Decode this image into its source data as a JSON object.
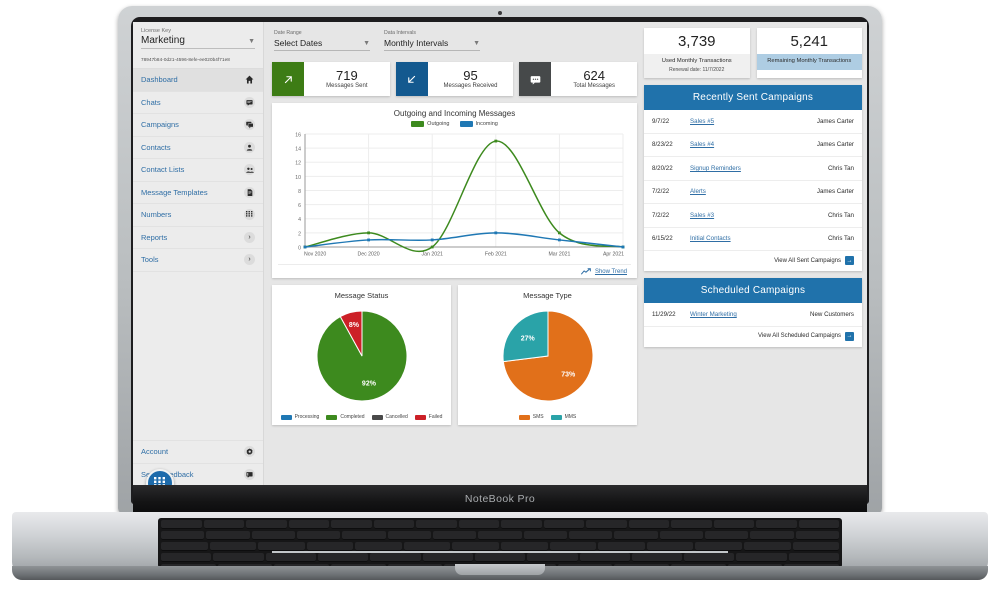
{
  "device": {
    "brand_label": "NoteBook Pro"
  },
  "sidebar": {
    "license_label": "License Key",
    "license_value": "Marketing",
    "license_key": "78947b84-0d21-4596-8efe-ee020b4f71e8",
    "items": [
      {
        "label": "Dashboard",
        "icon": "home-icon",
        "glyph": "⌂",
        "active": true
      },
      {
        "label": "Chats",
        "icon": "chat-icon",
        "glyph": "▤",
        "active": false
      },
      {
        "label": "Campaigns",
        "icon": "chats-icon",
        "glyph": "❐",
        "active": false
      },
      {
        "label": "Contacts",
        "icon": "person-icon",
        "glyph": "●",
        "active": false
      },
      {
        "label": "Contact Lists",
        "icon": "people-icon",
        "glyph": "●",
        "active": false
      },
      {
        "label": "Message Templates",
        "icon": "document-icon",
        "glyph": "▤",
        "active": false
      },
      {
        "label": "Numbers",
        "icon": "keypad-icon",
        "glyph": "∷",
        "active": false
      },
      {
        "label": "Reports",
        "icon": "chevron-right-icon",
        "glyph": "›",
        "active": false
      },
      {
        "label": "Tools",
        "icon": "chevron-right-icon",
        "glyph": "›",
        "active": false
      }
    ],
    "bottom_items": [
      {
        "label": "Account",
        "icon": "gear-icon",
        "glyph": "⚙"
      },
      {
        "label": "Send Feedback",
        "icon": "feedback-icon",
        "glyph": "▤"
      }
    ],
    "fab_icon": "apps-grid-icon",
    "fab_glyph": "☷"
  },
  "filters": [
    {
      "label": "Date Range",
      "value": "Select Dates"
    },
    {
      "label": "Data Intervals",
      "value": "Monthly Intervals"
    }
  ],
  "stats": [
    {
      "value": "719",
      "caption": "Messages Sent",
      "color": "#3d7c15",
      "icon": "arrow-up-right-icon",
      "glyph": "↗"
    },
    {
      "value": "95",
      "caption": "Messages Received",
      "color": "#13598f",
      "icon": "arrow-down-left-icon",
      "glyph": "↙"
    },
    {
      "value": "624",
      "caption": "Total Messages",
      "color": "#46494a",
      "icon": "message-icon",
      "glyph": "▤"
    }
  ],
  "transactions": [
    {
      "value": "3,739",
      "caption": "Used Monthly Transactions",
      "sub": "Renewal date: 11/7/2022",
      "style": "grey"
    },
    {
      "value": "5,241",
      "caption": "Remaining Monthly Transactions",
      "sub": "",
      "style": "blue"
    }
  ],
  "line_card": {
    "trend_link": "Show Trend",
    "trend_icon": "trend-line-icon"
  },
  "recently_sent": {
    "title": "Recently Sent Campaigns",
    "rows": [
      {
        "date": "9/7/22",
        "name": "Sales #5",
        "owner": "James Carter"
      },
      {
        "date": "8/23/22",
        "name": "Sales #4",
        "owner": "James Carter"
      },
      {
        "date": "8/20/22",
        "name": "Signup Reminders",
        "owner": "Chris Tan"
      },
      {
        "date": "7/2/22",
        "name": "Alerts",
        "owner": "James Carter"
      },
      {
        "date": "7/2/22",
        "name": "Sales #3",
        "owner": "Chris Tan"
      },
      {
        "date": "6/15/22",
        "name": "Initial Contacts",
        "owner": "Chris Tan"
      }
    ],
    "footer_label": "View All Sent Campaigns",
    "footer_icon": "arrow-right-box-icon"
  },
  "scheduled": {
    "title": "Scheduled Campaigns",
    "rows": [
      {
        "date": "11/29/22",
        "name": "Winter Marketing",
        "owner": "New Customers"
      }
    ],
    "footer_label": "View All Scheduled Campaigns",
    "footer_icon": "arrow-right-box-icon"
  },
  "chart_data": [
    {
      "type": "line",
      "title": "Outgoing and Incoming Messages",
      "categories": [
        "Nov 2020",
        "Dec 2020",
        "Jan 2021",
        "Feb 2021",
        "Mar 2021",
        "Apr 2021"
      ],
      "series": [
        {
          "name": "Outgoing",
          "values": [
            0,
            2,
            0,
            15,
            2,
            0
          ],
          "color": "#3d8a1e"
        },
        {
          "name": "Incoming",
          "values": [
            0,
            1,
            1,
            2,
            1,
            0
          ],
          "color": "#1f78b4"
        }
      ],
      "xlabel": "",
      "ylabel": "",
      "ylim": [
        0,
        16
      ],
      "yticks": [
        0,
        2,
        4,
        6,
        8,
        10,
        12,
        14,
        16
      ],
      "grid": true,
      "legend": "top"
    },
    {
      "type": "pie",
      "title": "Message Status",
      "labels": [
        "Processing",
        "Completed",
        "Cancelled",
        "Failed"
      ],
      "values": [
        0,
        92,
        0,
        8
      ],
      "value_labels": [
        "",
        "92%",
        "",
        "8%"
      ],
      "colors": [
        "#1f78b4",
        "#3d8a1e",
        "#4a4a4a",
        "#cc2027"
      ],
      "legend": "bottom"
    },
    {
      "type": "pie",
      "title": "Message Type",
      "labels": [
        "SMS",
        "MMS"
      ],
      "values": [
        73,
        27
      ],
      "value_labels": [
        "73%",
        "27%"
      ],
      "colors": [
        "#e1701a",
        "#2aa3a8"
      ],
      "legend": "bottom"
    }
  ]
}
